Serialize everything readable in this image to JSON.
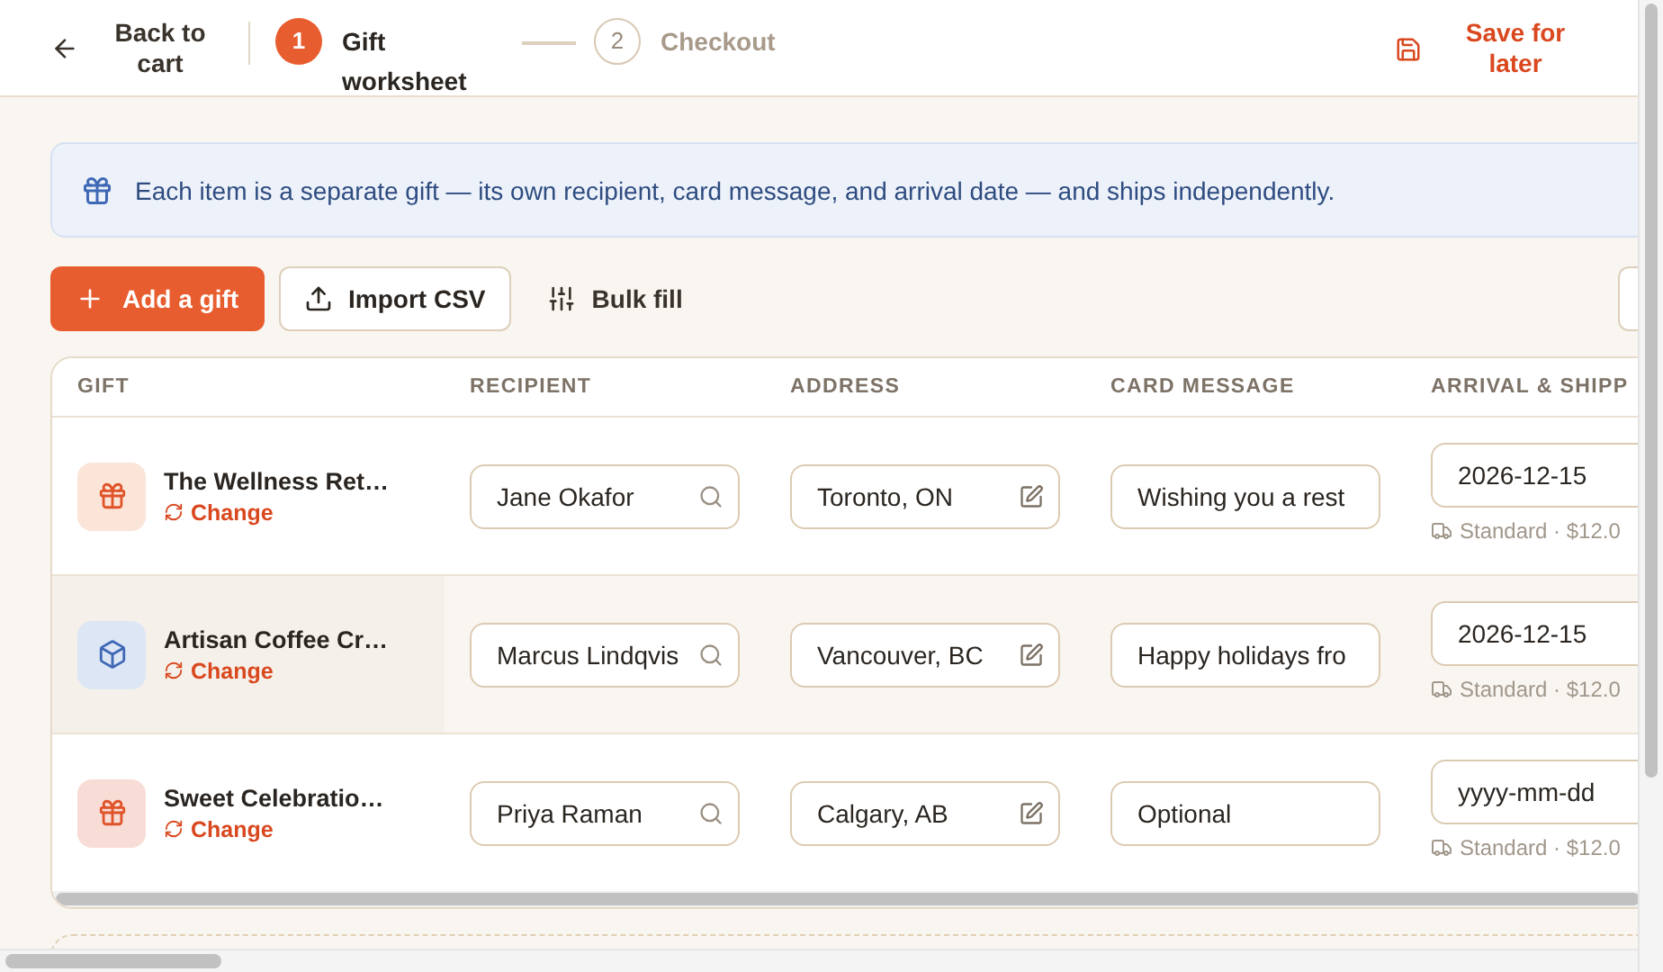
{
  "header": {
    "back": "Back to cart",
    "steps": [
      {
        "number": "1",
        "label": "Gift worksheet",
        "selected": true
      },
      {
        "number": "2",
        "label": "Checkout",
        "selected": false
      }
    ],
    "save": "Save for later"
  },
  "banner": "Each item is a separate gift — its own recipient, card message, and arrival date — and ships independently.",
  "toolbar": {
    "add": "Add a gift",
    "import": "Import CSV",
    "bulk": "Bulk fill"
  },
  "table": {
    "columns": [
      "GIFT",
      "RECIPIENT",
      "ADDRESS",
      "CARD MESSAGE",
      "ARRIVAL & SHIPP"
    ],
    "rows": [
      {
        "name": "The Wellness Ret…",
        "kind": "gift",
        "color": "#fbe4d8",
        "change": "Change",
        "recipient": "Jane Okafor",
        "address": "Toronto, ON",
        "message": {
          "value": "Wishing you a rest"
        },
        "arrival": {
          "value": "2026-12-15"
        },
        "shipping": "Standard · $12.0",
        "highlighted": false
      },
      {
        "name": "Artisan Coffee Cr…",
        "kind": "box",
        "color": "#dde6f5",
        "change": "Change",
        "recipient": "Marcus Lindqvis",
        "address": "Vancouver, BC",
        "message": {
          "value": "Happy holidays fro"
        },
        "arrival": {
          "value": "2026-12-15"
        },
        "shipping": "Standard · $12.0",
        "highlighted": true
      },
      {
        "name": "Sweet Celebratio…",
        "kind": "gift",
        "color": "#f8ddd6",
        "change": "Change",
        "recipient": "Priya Raman",
        "address": "Calgary, AB",
        "message": {
          "placeholder": "Optional"
        },
        "arrival": {
          "placeholder": "yyyy-mm-dd"
        },
        "shipping": "Standard · $12.0",
        "highlighted": false
      }
    ]
  }
}
